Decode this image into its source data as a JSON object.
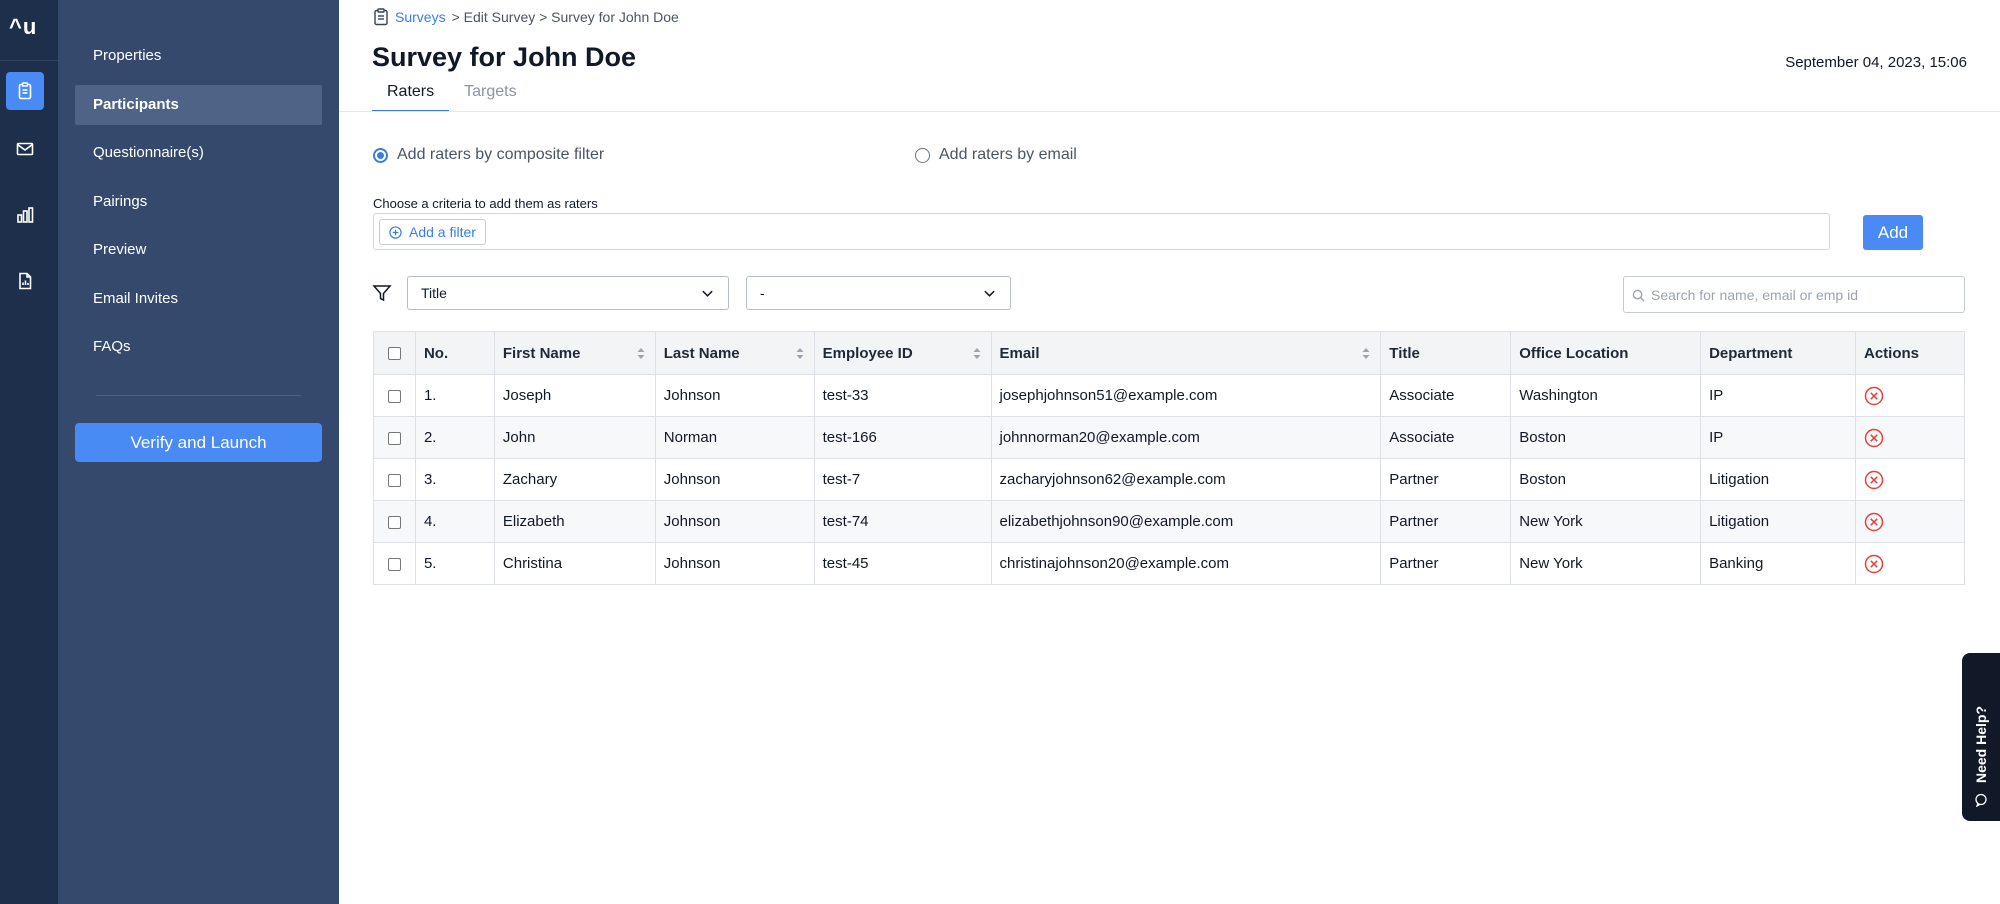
{
  "app": {
    "logo": "^u"
  },
  "rail": {
    "items": [
      "clipboard-icon",
      "mail-icon",
      "bar-chart-icon",
      "report-icon"
    ]
  },
  "sidebar": {
    "items": [
      {
        "label": "Properties"
      },
      {
        "label": "Participants",
        "active": true
      },
      {
        "label": "Questionnaire(s)"
      },
      {
        "label": "Pairings"
      },
      {
        "label": "Preview"
      },
      {
        "label": "Email Invites"
      },
      {
        "label": "FAQs"
      }
    ],
    "launch_label": "Verify and Launch"
  },
  "breadcrumb": {
    "link": "Surveys",
    "rest": "> Edit Survey > Survey for John Doe"
  },
  "header": {
    "title": "Survey for John Doe",
    "timestamp": "September 04, 2023, 15:06",
    "tabs": [
      {
        "label": "Raters",
        "active": true
      },
      {
        "label": "Targets"
      }
    ]
  },
  "raters": {
    "radio_composite": "Add raters by composite filter",
    "radio_email": "Add raters by email",
    "selected": "composite",
    "criteria_label": "Choose a criteria to add them as raters",
    "add_filter_label": "Add a filter",
    "add_label": "Add"
  },
  "filters": {
    "field_value": "Title",
    "operator_value": "-",
    "search_placeholder": "Search for name, email or emp id"
  },
  "table": {
    "headers": {
      "no": "No.",
      "first_name": "First Name",
      "last_name": "Last Name",
      "employee_id": "Employee ID",
      "email": "Email",
      "title": "Title",
      "office_location": "Office Location",
      "department": "Department",
      "actions": "Actions"
    },
    "rows": [
      {
        "no": "1.",
        "first_name": "Joseph",
        "last_name": "Johnson",
        "employee_id": "test-33",
        "email": "josephjohnson51@example.com",
        "title": "Associate",
        "office_location": "Washington",
        "department": "IP"
      },
      {
        "no": "2.",
        "first_name": "John",
        "last_name": "Norman",
        "employee_id": "test-166",
        "email": "johnnorman20@example.com",
        "title": "Associate",
        "office_location": "Boston",
        "department": "IP"
      },
      {
        "no": "3.",
        "first_name": "Zachary",
        "last_name": "Johnson",
        "employee_id": "test-7",
        "email": "zacharyjohnson62@example.com",
        "title": "Partner",
        "office_location": "Boston",
        "department": "Litigation"
      },
      {
        "no": "4.",
        "first_name": "Elizabeth",
        "last_name": "Johnson",
        "employee_id": "test-74",
        "email": "elizabethjohnson90@example.com",
        "title": "Partner",
        "office_location": "New York",
        "department": "Litigation"
      },
      {
        "no": "5.",
        "first_name": "Christina",
        "last_name": "Johnson",
        "employee_id": "test-45",
        "email": "christinajohnson20@example.com",
        "title": "Partner",
        "office_location": "New York",
        "department": "Banking"
      }
    ]
  },
  "help": {
    "label": "Need Help?"
  },
  "colors": {
    "accent": "#4a8af4",
    "sidebar": "#34496b",
    "rail": "#1d2f4a",
    "remove": "#e0443c"
  }
}
